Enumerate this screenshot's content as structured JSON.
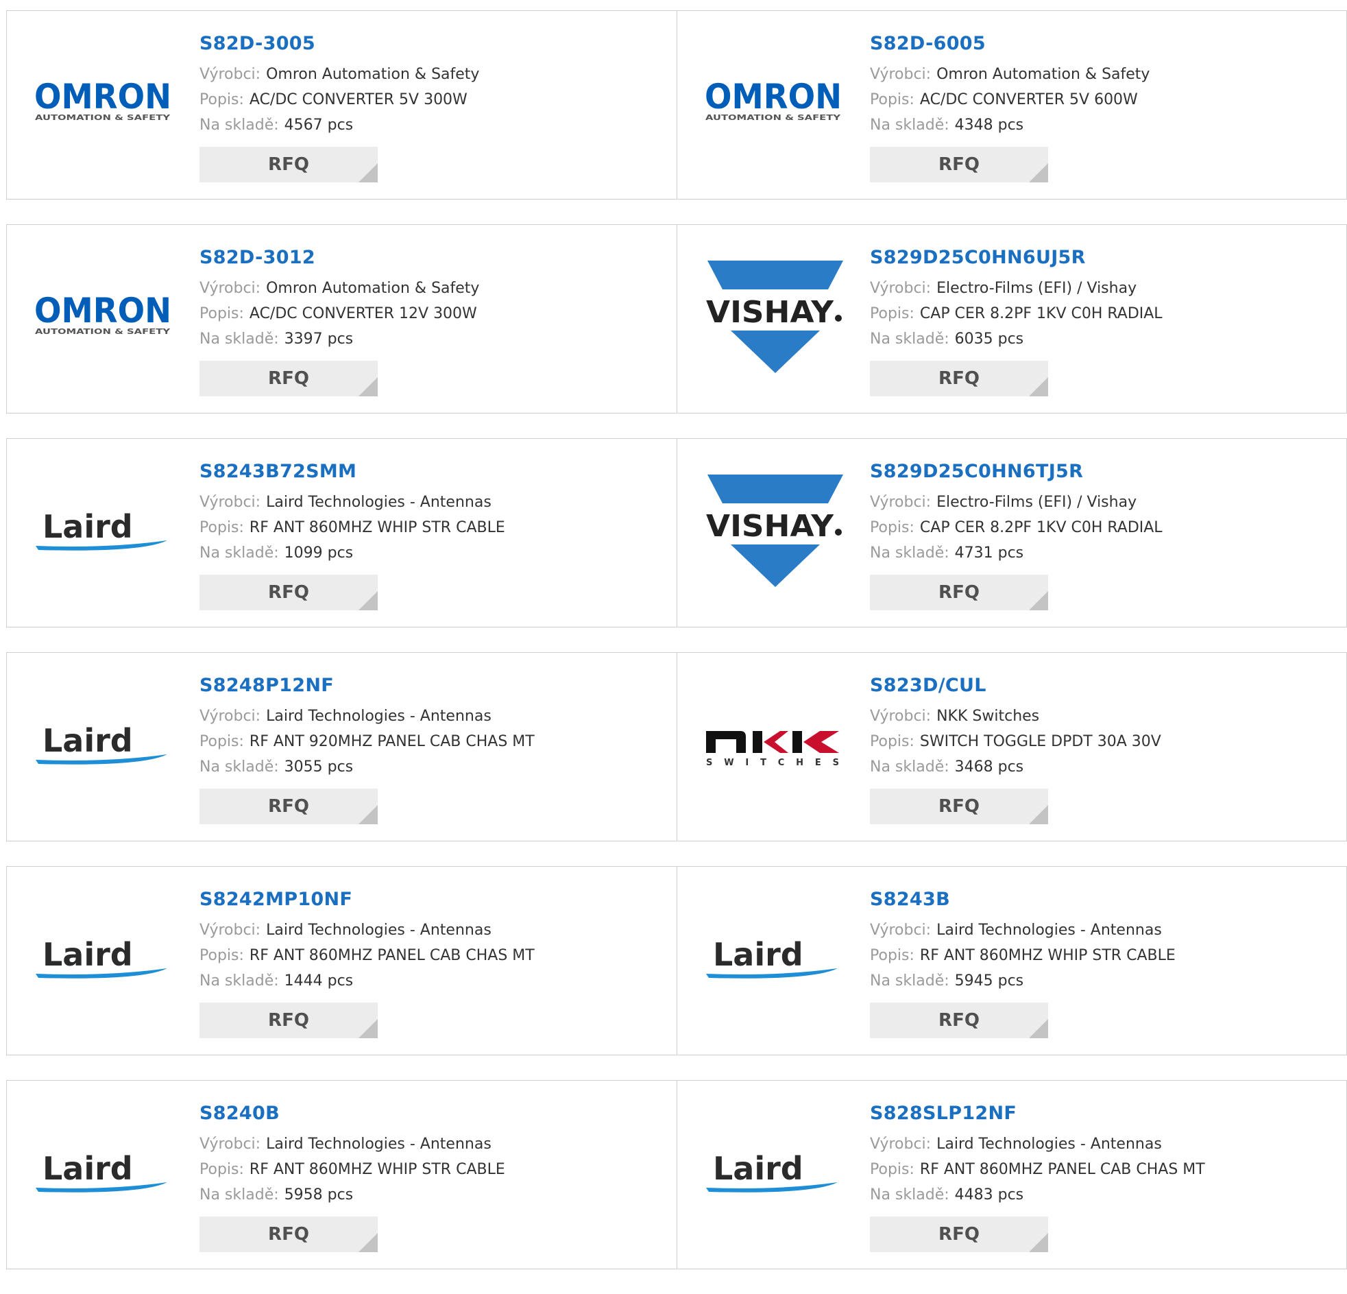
{
  "labels": {
    "manufacturer": "Výrobci:",
    "description": "Popis:",
    "stock": "Na skladě:",
    "rfq": "RFQ"
  },
  "logo_text": {
    "omron": "OMRON",
    "omron_sub": "AUTOMATION & SAFETY",
    "vishay": "VISHAY",
    "laird": "Laird",
    "nkk_sub": "SWITCHES"
  },
  "colors": {
    "part_link": "#1a6fc1",
    "omron": "#005eb8",
    "vishay": "#2a7cc7",
    "laird_swoosh": "#1e8fd6",
    "label_gray": "#9a9a9a",
    "rfq_bg": "#ececec"
  },
  "products": [
    {
      "part": "S82D-3005",
      "manufacturer": "Omron Automation & Safety",
      "description": "AC/DC CONVERTER 5V 300W",
      "stock": "4567 pcs",
      "logo": "omron"
    },
    {
      "part": "S82D-6005",
      "manufacturer": "Omron Automation & Safety",
      "description": "AC/DC CONVERTER 5V 600W",
      "stock": "4348 pcs",
      "logo": "omron"
    },
    {
      "part": "S82D-3012",
      "manufacturer": "Omron Automation & Safety",
      "description": "AC/DC CONVERTER 12V 300W",
      "stock": "3397 pcs",
      "logo": "omron"
    },
    {
      "part": "S829D25C0HN6UJ5R",
      "manufacturer": "Electro-Films (EFI) / Vishay",
      "description": "CAP CER 8.2PF 1KV C0H RADIAL",
      "stock": "6035 pcs",
      "logo": "vishay"
    },
    {
      "part": "S8243B72SMM",
      "manufacturer": "Laird Technologies - Antennas",
      "description": "RF ANT 860MHZ WHIP STR CABLE",
      "stock": "1099 pcs",
      "logo": "laird"
    },
    {
      "part": "S829D25C0HN6TJ5R",
      "manufacturer": "Electro-Films (EFI) / Vishay",
      "description": "CAP CER 8.2PF 1KV C0H RADIAL",
      "stock": "4731 pcs",
      "logo": "vishay"
    },
    {
      "part": "S8248P12NF",
      "manufacturer": "Laird Technologies - Antennas",
      "description": "RF ANT 920MHZ PANEL CAB CHAS MT",
      "stock": "3055 pcs",
      "logo": "laird"
    },
    {
      "part": "S823D/CUL",
      "manufacturer": "NKK Switches",
      "description": "SWITCH TOGGLE DPDT 30A 30V",
      "stock": "3468 pcs",
      "logo": "nkk"
    },
    {
      "part": "S8242MP10NF",
      "manufacturer": "Laird Technologies - Antennas",
      "description": "RF ANT 860MHZ PANEL CAB CHAS MT",
      "stock": "1444 pcs",
      "logo": "laird"
    },
    {
      "part": "S8243B",
      "manufacturer": "Laird Technologies - Antennas",
      "description": "RF ANT 860MHZ WHIP STR CABLE",
      "stock": "5945 pcs",
      "logo": "laird"
    },
    {
      "part": "S8240B",
      "manufacturer": "Laird Technologies - Antennas",
      "description": "RF ANT 860MHZ WHIP STR CABLE",
      "stock": "5958 pcs",
      "logo": "laird"
    },
    {
      "part": "S828SLP12NF",
      "manufacturer": "Laird Technologies - Antennas",
      "description": "RF ANT 860MHZ PANEL CAB CHAS MT",
      "stock": "4483 pcs",
      "logo": "laird"
    }
  ]
}
